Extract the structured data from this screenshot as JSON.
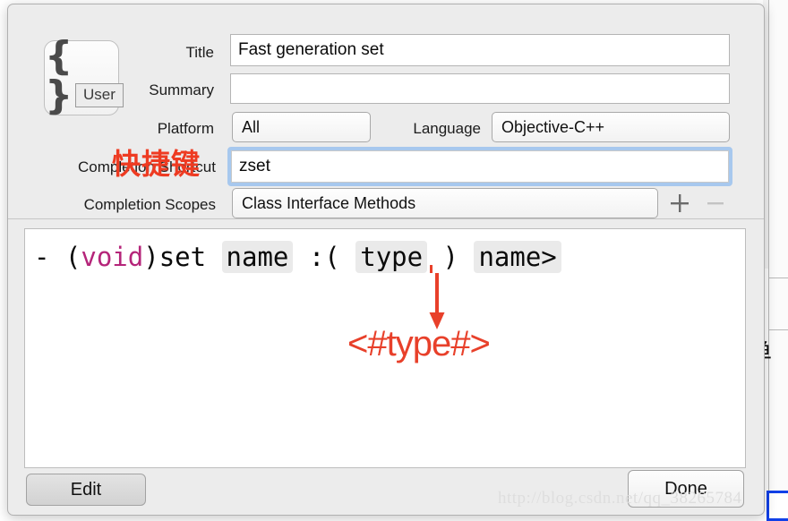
{
  "dialog": {
    "snippet_icon": {
      "braces": "{ }",
      "badge_label": "User"
    },
    "fields": [
      {
        "label": "Title",
        "value": "Fast generation set"
      },
      {
        "label": "Summary",
        "value": ""
      }
    ],
    "platform": {
      "label": "Platform",
      "value": "All"
    },
    "language": {
      "label": "Language",
      "value": "Objective-C++"
    },
    "completion_shortcut": {
      "label": "Completion Shortcut",
      "value": "zset"
    },
    "completion_scopes": {
      "label": "Completion Scopes",
      "value": "Class Interface Methods",
      "add_label": "+",
      "remove_label": "−"
    },
    "code": {
      "tokens": [
        {
          "text": "- (",
          "kind": "plain"
        },
        {
          "text": "void",
          "kind": "keyword"
        },
        {
          "text": ")set ",
          "kind": "plain"
        },
        {
          "text": "name",
          "kind": "placeholder"
        },
        {
          "text": " :( ",
          "kind": "plain"
        },
        {
          "text": "type",
          "kind": "placeholder"
        },
        {
          "text": " ) ",
          "kind": "plain"
        },
        {
          "text": "name>",
          "kind": "placeholder"
        }
      ]
    },
    "footer": {
      "edit_label": "Edit",
      "done_label": "Done"
    }
  },
  "annotations": {
    "shortcut_cn": "快捷键",
    "type_placeholder": "<#type#>",
    "color": "#e8402a"
  },
  "watermark": {
    "text": "http://blog.csdn.net/qq_38265784"
  },
  "background": {
    "cjk_char": "单"
  }
}
